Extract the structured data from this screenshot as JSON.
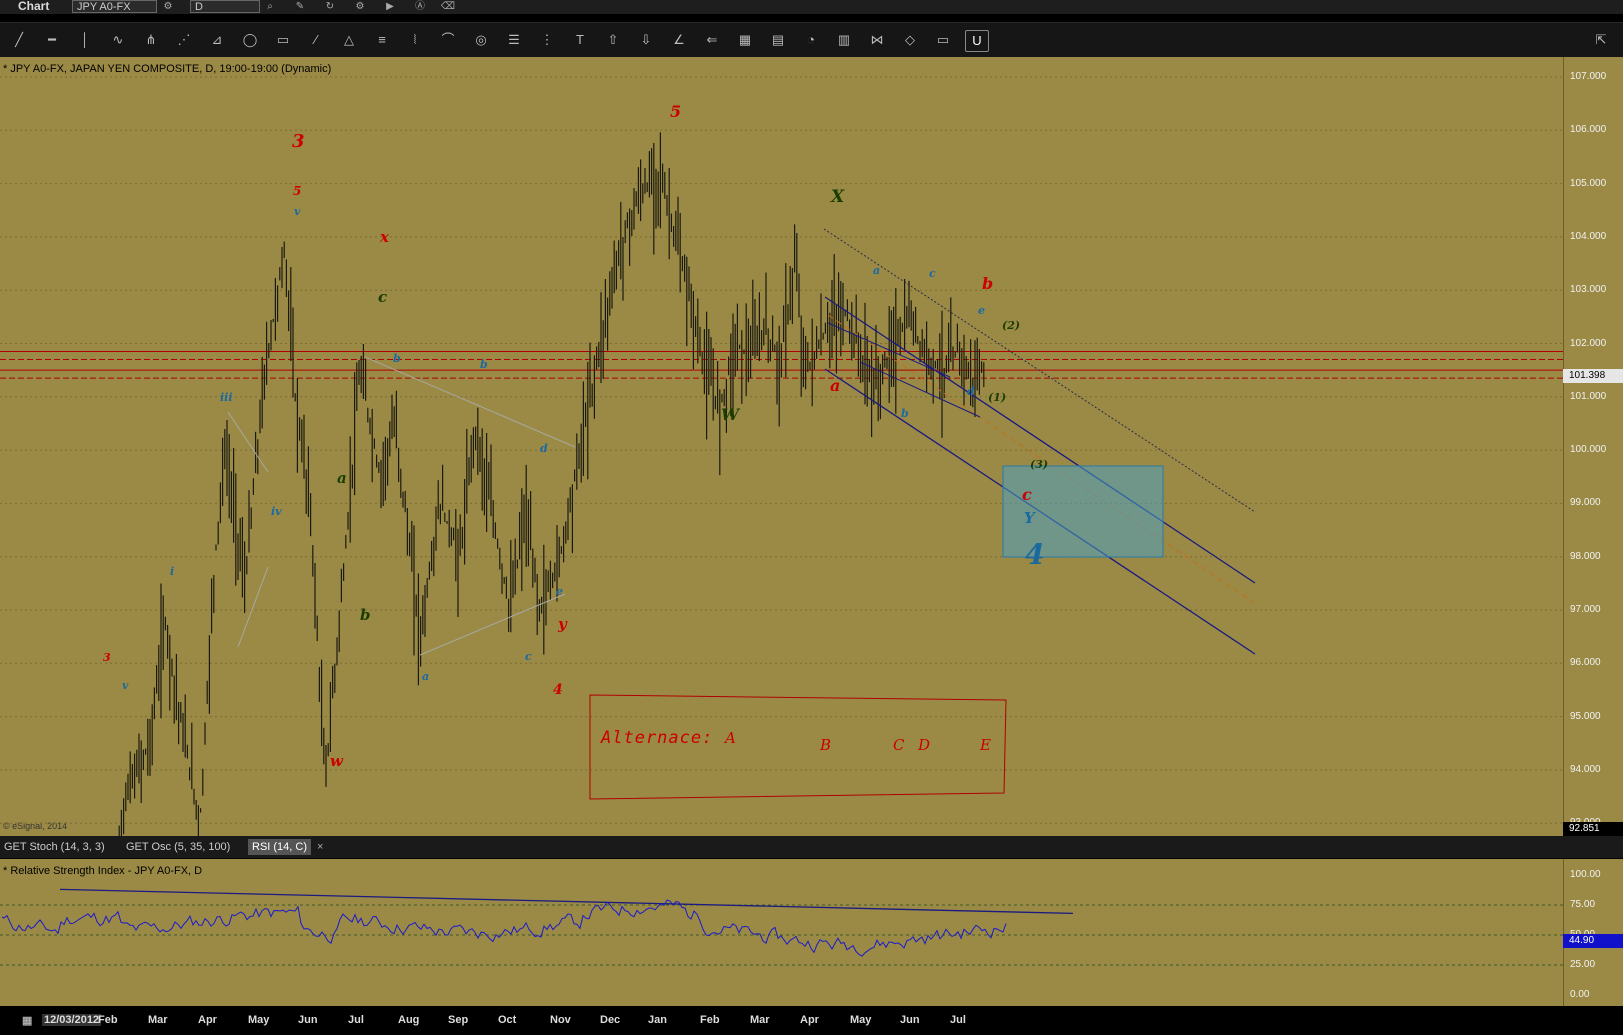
{
  "window": {
    "title": "Chart",
    "symbol": "JPY A0-FX",
    "interval": "D"
  },
  "titlebar_icons": [
    "link-icon",
    "lock-icon",
    "pencil-icon",
    "refresh-icon",
    "settings-icon",
    "play-icon",
    "alert-icon",
    "eraser-icon"
  ],
  "toolbar": {
    "tools": [
      "line-tool",
      "horizontal-line-tool",
      "vertical-line-tool",
      "wave-tool",
      "pitchfork-tool",
      "fan-tool",
      "gann-tool",
      "ellipse-tool",
      "rectangle-tool",
      "brush-tool",
      "triangle-tool",
      "channel-tool",
      "cycle-tool",
      "fibonacci-tool",
      "spiral-tool",
      "levels-tool",
      "bars-tool",
      "text-tool",
      "arrow-up-tool",
      "arrow-down-tool",
      "angle-tool",
      "trend-tool",
      "grid-tool",
      "mob-tool",
      "circle-tool",
      "pti-tool",
      "zigzag-tool",
      "eraser-tool",
      "comment-tool",
      "magnet-tool"
    ]
  },
  "chart": {
    "title": "* JPY A0-FX, JAPAN YEN COMPOSITE, D, 19:00-19:00 (Dynamic)",
    "copyright": "© eSignal, 2014",
    "price_ticks": [
      "107.000",
      "106.000",
      "105.000",
      "104.000",
      "103.000",
      "102.000",
      "101.000",
      "100.000",
      "99.000",
      "98.000",
      "97.000",
      "96.000",
      "95.000",
      "94.000",
      "93.000"
    ],
    "last_price": "101.398",
    "low_price": "92.851",
    "colors": {
      "background": "#9b8a45",
      "price_tag": "#e6e6e6",
      "rsi_tag": "#1111cc"
    },
    "wave_labels": [
      {
        "text": "3",
        "color": "#cc0000"
      },
      {
        "text": "5",
        "color": "#cc0000"
      },
      {
        "text": "x",
        "color": "#cc0000"
      },
      {
        "text": "c",
        "color": "#1a3d00"
      },
      {
        "text": "5",
        "color": "#cc0000"
      },
      {
        "text": "X",
        "color": "#1a3d00"
      },
      {
        "text": "a",
        "color": "#1a6aa0"
      },
      {
        "text": "c",
        "color": "#1a6aa0"
      },
      {
        "text": "b",
        "color": "#cc0000"
      },
      {
        "text": "e",
        "color": "#1a6aa0"
      },
      {
        "text": "(2)",
        "color": "#1a3d00"
      },
      {
        "text": "a",
        "color": "#cc0000"
      },
      {
        "text": "W",
        "color": "#1a3d00"
      },
      {
        "text": "b",
        "color": "#1a6aa0"
      },
      {
        "text": "d",
        "color": "#1a6aa0"
      },
      {
        "text": "(1)",
        "color": "#1a3d00"
      },
      {
        "text": "(3)",
        "color": "#1a3d00"
      },
      {
        "text": "c",
        "color": "#cc0000"
      },
      {
        "text": "Y",
        "color": "#1a6aa0"
      },
      {
        "text": "4",
        "color": "#1a6aa0"
      },
      {
        "text": "iii",
        "color": "#1a6aa0"
      },
      {
        "text": "iv",
        "color": "#1a6aa0"
      },
      {
        "text": "i",
        "color": "#1a6aa0"
      },
      {
        "text": "v",
        "color": "#1a6aa0"
      },
      {
        "text": "v",
        "color": "#1a6aa0"
      },
      {
        "text": "3",
        "color": "#cc0000"
      },
      {
        "text": "a",
        "color": "#1a3d00"
      },
      {
        "text": "b",
        "color": "#1a3d00"
      },
      {
        "text": "w",
        "color": "#cc0000"
      },
      {
        "text": "b",
        "color": "#1a6aa0"
      },
      {
        "text": "b",
        "color": "#1a6aa0"
      },
      {
        "text": "d",
        "color": "#1a6aa0"
      },
      {
        "text": "a",
        "color": "#1a6aa0"
      },
      {
        "text": "c",
        "color": "#1a6aa0"
      },
      {
        "text": "e",
        "color": "#1a6aa0"
      },
      {
        "text": "y",
        "color": "#cc0000"
      },
      {
        "text": "4",
        "color": "#cc0000"
      }
    ],
    "alternace": {
      "label": "Alternace:",
      "letters": [
        "A",
        "B",
        "C",
        "D",
        "E"
      ]
    }
  },
  "indicator_tabs": [
    {
      "label": "GET Stoch (14, 3, 3)"
    },
    {
      "label": "GET Osc (5, 35, 100)"
    },
    {
      "label": "RSI (14, C)",
      "selected": true
    }
  ],
  "tab_close": "×",
  "rsi": {
    "title": "* Relative Strength Index - JPY A0-FX, D",
    "ticks": [
      "100.00",
      "75.00",
      "50.00",
      "25.00",
      "0.00"
    ],
    "last_value": "44.90"
  },
  "time_axis": {
    "start_date": "12/03/2012",
    "months": [
      "Feb",
      "Mar",
      "Apr",
      "May",
      "Jun",
      "Jul",
      "Aug",
      "Sep",
      "Oct",
      "Nov",
      "Dec",
      "Jan",
      "Feb",
      "Mar",
      "Apr",
      "May",
      "Jun",
      "Jul"
    ]
  }
}
